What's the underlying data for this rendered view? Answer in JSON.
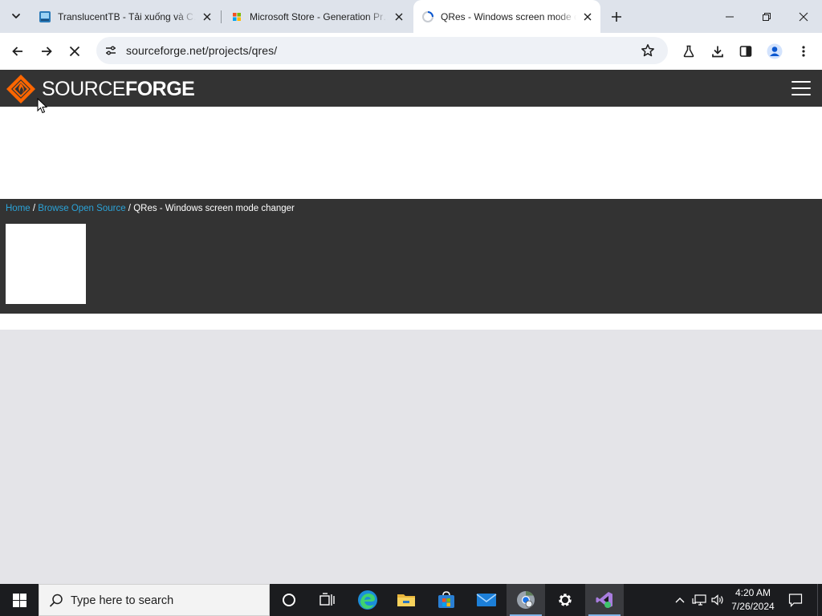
{
  "browser": {
    "tabs": [
      {
        "title": "TranslucentTB - Tải xuống và C…",
        "favicon": "translucenttb-favicon"
      },
      {
        "title": "Microsoft Store - Generation Pr…",
        "favicon": "microsoft-store-favicon"
      },
      {
        "title": "QRes - Windows screen mode c…",
        "favicon": "loading-spinner-favicon",
        "active": true
      }
    ],
    "url": "sourceforge.net/projects/qres/"
  },
  "page": {
    "brand_light": "SOURCE",
    "brand_bold": "FORGE",
    "breadcrumb": {
      "home": "Home",
      "sep1": " / ",
      "browse": "Browse Open Source",
      "sep2": " / ",
      "current": "QRes - Windows screen mode changer"
    },
    "colors": {
      "header": "#333333",
      "link": "#2ba3d8",
      "logo_orange": "#ff6600",
      "background": "#e4e4e8"
    }
  },
  "taskbar": {
    "search_placeholder": "Type here to search",
    "time": "4:20 AM",
    "date": "7/26/2024",
    "apps": [
      "task-view",
      "cortana",
      "edge",
      "file-explorer",
      "microsoft-store",
      "mail",
      "chrome",
      "settings",
      "visual-studio"
    ]
  }
}
